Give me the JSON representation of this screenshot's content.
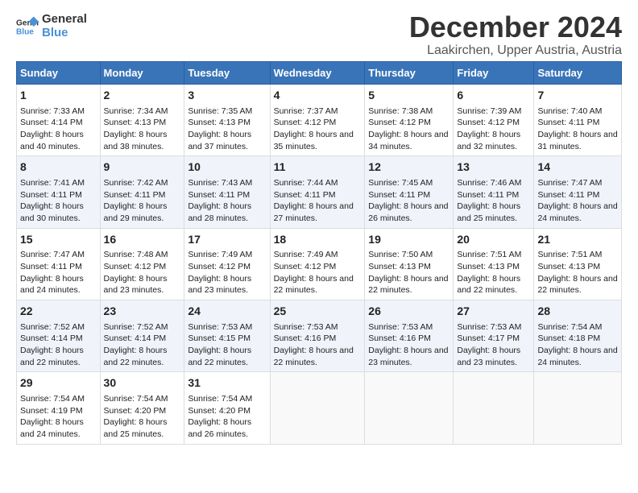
{
  "logo": {
    "line1": "General",
    "line2": "Blue"
  },
  "title": "December 2024",
  "subtitle": "Laakirchen, Upper Austria, Austria",
  "days_header": [
    "Sunday",
    "Monday",
    "Tuesday",
    "Wednesday",
    "Thursday",
    "Friday",
    "Saturday"
  ],
  "weeks": [
    [
      {
        "day": "1",
        "sunrise": "Sunrise: 7:33 AM",
        "sunset": "Sunset: 4:14 PM",
        "daylight": "Daylight: 8 hours and 40 minutes."
      },
      {
        "day": "2",
        "sunrise": "Sunrise: 7:34 AM",
        "sunset": "Sunset: 4:13 PM",
        "daylight": "Daylight: 8 hours and 38 minutes."
      },
      {
        "day": "3",
        "sunrise": "Sunrise: 7:35 AM",
        "sunset": "Sunset: 4:13 PM",
        "daylight": "Daylight: 8 hours and 37 minutes."
      },
      {
        "day": "4",
        "sunrise": "Sunrise: 7:37 AM",
        "sunset": "Sunset: 4:12 PM",
        "daylight": "Daylight: 8 hours and 35 minutes."
      },
      {
        "day": "5",
        "sunrise": "Sunrise: 7:38 AM",
        "sunset": "Sunset: 4:12 PM",
        "daylight": "Daylight: 8 hours and 34 minutes."
      },
      {
        "day": "6",
        "sunrise": "Sunrise: 7:39 AM",
        "sunset": "Sunset: 4:12 PM",
        "daylight": "Daylight: 8 hours and 32 minutes."
      },
      {
        "day": "7",
        "sunrise": "Sunrise: 7:40 AM",
        "sunset": "Sunset: 4:11 PM",
        "daylight": "Daylight: 8 hours and 31 minutes."
      }
    ],
    [
      {
        "day": "8",
        "sunrise": "Sunrise: 7:41 AM",
        "sunset": "Sunset: 4:11 PM",
        "daylight": "Daylight: 8 hours and 30 minutes."
      },
      {
        "day": "9",
        "sunrise": "Sunrise: 7:42 AM",
        "sunset": "Sunset: 4:11 PM",
        "daylight": "Daylight: 8 hours and 29 minutes."
      },
      {
        "day": "10",
        "sunrise": "Sunrise: 7:43 AM",
        "sunset": "Sunset: 4:11 PM",
        "daylight": "Daylight: 8 hours and 28 minutes."
      },
      {
        "day": "11",
        "sunrise": "Sunrise: 7:44 AM",
        "sunset": "Sunset: 4:11 PM",
        "daylight": "Daylight: 8 hours and 27 minutes."
      },
      {
        "day": "12",
        "sunrise": "Sunrise: 7:45 AM",
        "sunset": "Sunset: 4:11 PM",
        "daylight": "Daylight: 8 hours and 26 minutes."
      },
      {
        "day": "13",
        "sunrise": "Sunrise: 7:46 AM",
        "sunset": "Sunset: 4:11 PM",
        "daylight": "Daylight: 8 hours and 25 minutes."
      },
      {
        "day": "14",
        "sunrise": "Sunrise: 7:47 AM",
        "sunset": "Sunset: 4:11 PM",
        "daylight": "Daylight: 8 hours and 24 minutes."
      }
    ],
    [
      {
        "day": "15",
        "sunrise": "Sunrise: 7:47 AM",
        "sunset": "Sunset: 4:11 PM",
        "daylight": "Daylight: 8 hours and 24 minutes."
      },
      {
        "day": "16",
        "sunrise": "Sunrise: 7:48 AM",
        "sunset": "Sunset: 4:12 PM",
        "daylight": "Daylight: 8 hours and 23 minutes."
      },
      {
        "day": "17",
        "sunrise": "Sunrise: 7:49 AM",
        "sunset": "Sunset: 4:12 PM",
        "daylight": "Daylight: 8 hours and 23 minutes."
      },
      {
        "day": "18",
        "sunrise": "Sunrise: 7:49 AM",
        "sunset": "Sunset: 4:12 PM",
        "daylight": "Daylight: 8 hours and 22 minutes."
      },
      {
        "day": "19",
        "sunrise": "Sunrise: 7:50 AM",
        "sunset": "Sunset: 4:13 PM",
        "daylight": "Daylight: 8 hours and 22 minutes."
      },
      {
        "day": "20",
        "sunrise": "Sunrise: 7:51 AM",
        "sunset": "Sunset: 4:13 PM",
        "daylight": "Daylight: 8 hours and 22 minutes."
      },
      {
        "day": "21",
        "sunrise": "Sunrise: 7:51 AM",
        "sunset": "Sunset: 4:13 PM",
        "daylight": "Daylight: 8 hours and 22 minutes."
      }
    ],
    [
      {
        "day": "22",
        "sunrise": "Sunrise: 7:52 AM",
        "sunset": "Sunset: 4:14 PM",
        "daylight": "Daylight: 8 hours and 22 minutes."
      },
      {
        "day": "23",
        "sunrise": "Sunrise: 7:52 AM",
        "sunset": "Sunset: 4:14 PM",
        "daylight": "Daylight: 8 hours and 22 minutes."
      },
      {
        "day": "24",
        "sunrise": "Sunrise: 7:53 AM",
        "sunset": "Sunset: 4:15 PM",
        "daylight": "Daylight: 8 hours and 22 minutes."
      },
      {
        "day": "25",
        "sunrise": "Sunrise: 7:53 AM",
        "sunset": "Sunset: 4:16 PM",
        "daylight": "Daylight: 8 hours and 22 minutes."
      },
      {
        "day": "26",
        "sunrise": "Sunrise: 7:53 AM",
        "sunset": "Sunset: 4:16 PM",
        "daylight": "Daylight: 8 hours and 23 minutes."
      },
      {
        "day": "27",
        "sunrise": "Sunrise: 7:53 AM",
        "sunset": "Sunset: 4:17 PM",
        "daylight": "Daylight: 8 hours and 23 minutes."
      },
      {
        "day": "28",
        "sunrise": "Sunrise: 7:54 AM",
        "sunset": "Sunset: 4:18 PM",
        "daylight": "Daylight: 8 hours and 24 minutes."
      }
    ],
    [
      {
        "day": "29",
        "sunrise": "Sunrise: 7:54 AM",
        "sunset": "Sunset: 4:19 PM",
        "daylight": "Daylight: 8 hours and 24 minutes."
      },
      {
        "day": "30",
        "sunrise": "Sunrise: 7:54 AM",
        "sunset": "Sunset: 4:20 PM",
        "daylight": "Daylight: 8 hours and 25 minutes."
      },
      {
        "day": "31",
        "sunrise": "Sunrise: 7:54 AM",
        "sunset": "Sunset: 4:20 PM",
        "daylight": "Daylight: 8 hours and 26 minutes."
      },
      null,
      null,
      null,
      null
    ]
  ]
}
